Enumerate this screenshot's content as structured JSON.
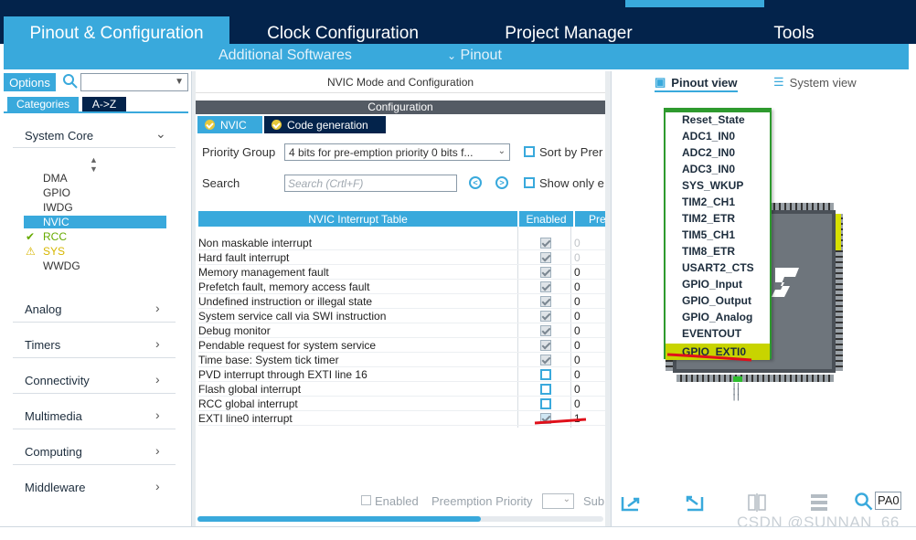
{
  "tabs": [
    "Pinout & Configuration",
    "Clock Configuration",
    "Project Manager",
    "Tools"
  ],
  "subbar": {
    "additional": "Additional Softwares",
    "pinout": "Pinout"
  },
  "left": {
    "options_label": "Options",
    "categories_tab": "Categories",
    "az_tab": "A->Z",
    "sections": [
      "System Core",
      "Analog",
      "Timers",
      "Connectivity",
      "Multimedia",
      "Computing",
      "Middleware"
    ],
    "system_core_items": [
      "DMA",
      "GPIO",
      "IWDG",
      "NVIC",
      "RCC",
      "SYS",
      "WWDG"
    ]
  },
  "middle": {
    "header": "NVIC Mode and Configuration",
    "configuration": "Configuration",
    "subtabs": [
      "NVIC",
      "Code generation"
    ],
    "priority_group_label": "Priority Group",
    "priority_group_value": "4 bits for pre-emption priority 0 bits f...",
    "sort_label": "Sort by Prer",
    "search_label": "Search",
    "search_placeholder": "Search (Crtl+F)",
    "show_only_label": "Show only e",
    "table_headers": [
      "NVIC Interrupt Table",
      "Enabled",
      "Pre"
    ],
    "rows": [
      {
        "name": "Non maskable interrupt",
        "enabled": true,
        "fixed": true,
        "priority": "0"
      },
      {
        "name": "Hard fault interrupt",
        "enabled": true,
        "fixed": true,
        "priority": "0"
      },
      {
        "name": "Memory management fault",
        "enabled": true,
        "fixed": false,
        "priority": "0"
      },
      {
        "name": "Prefetch fault, memory access fault",
        "enabled": true,
        "fixed": false,
        "priority": "0"
      },
      {
        "name": "Undefined instruction or illegal state",
        "enabled": true,
        "fixed": false,
        "priority": "0"
      },
      {
        "name": "System service call via SWI instruction",
        "enabled": true,
        "fixed": false,
        "priority": "0"
      },
      {
        "name": "Debug monitor",
        "enabled": true,
        "fixed": false,
        "priority": "0"
      },
      {
        "name": "Pendable request for system service",
        "enabled": true,
        "fixed": false,
        "priority": "0"
      },
      {
        "name": "Time base: System tick timer",
        "enabled": true,
        "fixed": false,
        "priority": "0"
      },
      {
        "name": "PVD interrupt through EXTI line 16",
        "enabled": false,
        "fixed": false,
        "priority": "0"
      },
      {
        "name": "Flash global interrupt",
        "enabled": false,
        "fixed": false,
        "priority": "0"
      },
      {
        "name": "RCC global interrupt",
        "enabled": false,
        "fixed": false,
        "priority": "0"
      },
      {
        "name": "EXTI line0 interrupt",
        "enabled": true,
        "fixed": false,
        "priority": "1"
      }
    ],
    "footer_enabled": "Enabled",
    "footer_preemption": "Preemption Priority",
    "footer_sub": "Sub"
  },
  "right": {
    "pinout_view": "Pinout view",
    "system_view": "System view",
    "menu_items": [
      "Reset_State",
      "ADC1_IN0",
      "ADC2_IN0",
      "ADC3_IN0",
      "SYS_WKUP",
      "TIM2_CH1",
      "TIM2_ETR",
      "TIM5_CH1",
      "TIM8_ETR",
      "USART2_CTS",
      "GPIO_Input",
      "GPIO_Output",
      "GPIO_Analog",
      "EVENTOUT",
      "GPIO_EXTI0"
    ],
    "pin_search_value": "PA0"
  },
  "watermark": "CSDN @SUNNAN_66",
  "colors": {
    "accent": "#39a9dc",
    "dark": "#03234b",
    "highlight": "#c8d400"
  }
}
